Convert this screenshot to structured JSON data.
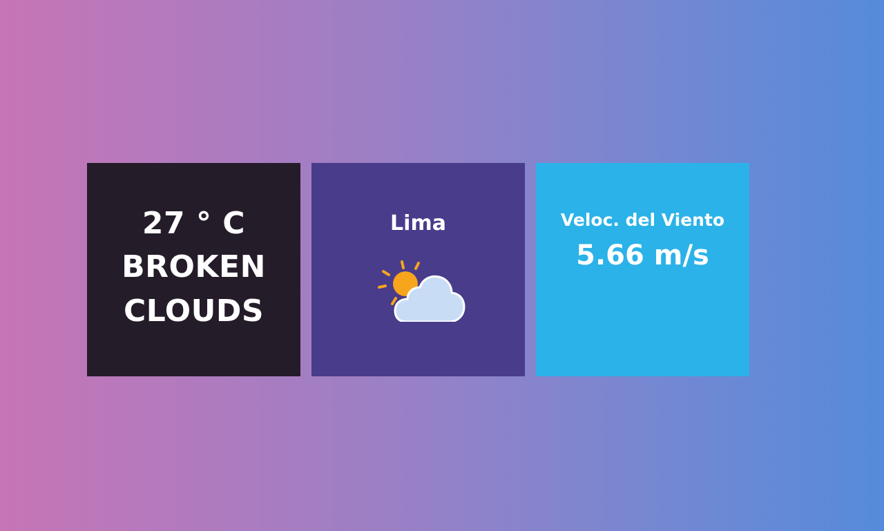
{
  "weather": {
    "temperature": "27 ° C",
    "description": "BROKEN CLOUDS",
    "city": "Lima",
    "icon": "partly-cloudy-icon",
    "wind_label": "Veloc. del Viento",
    "wind_value": "5.66 m/s"
  },
  "colors": {
    "background_start": "#c675b6",
    "background_end": "#558bdb",
    "temp_card": "#251c2a",
    "city_card": "#483c8b",
    "wind_card": "#2bb2e8",
    "sun": "#f6a51d",
    "cloud": "#c9dcf6"
  }
}
